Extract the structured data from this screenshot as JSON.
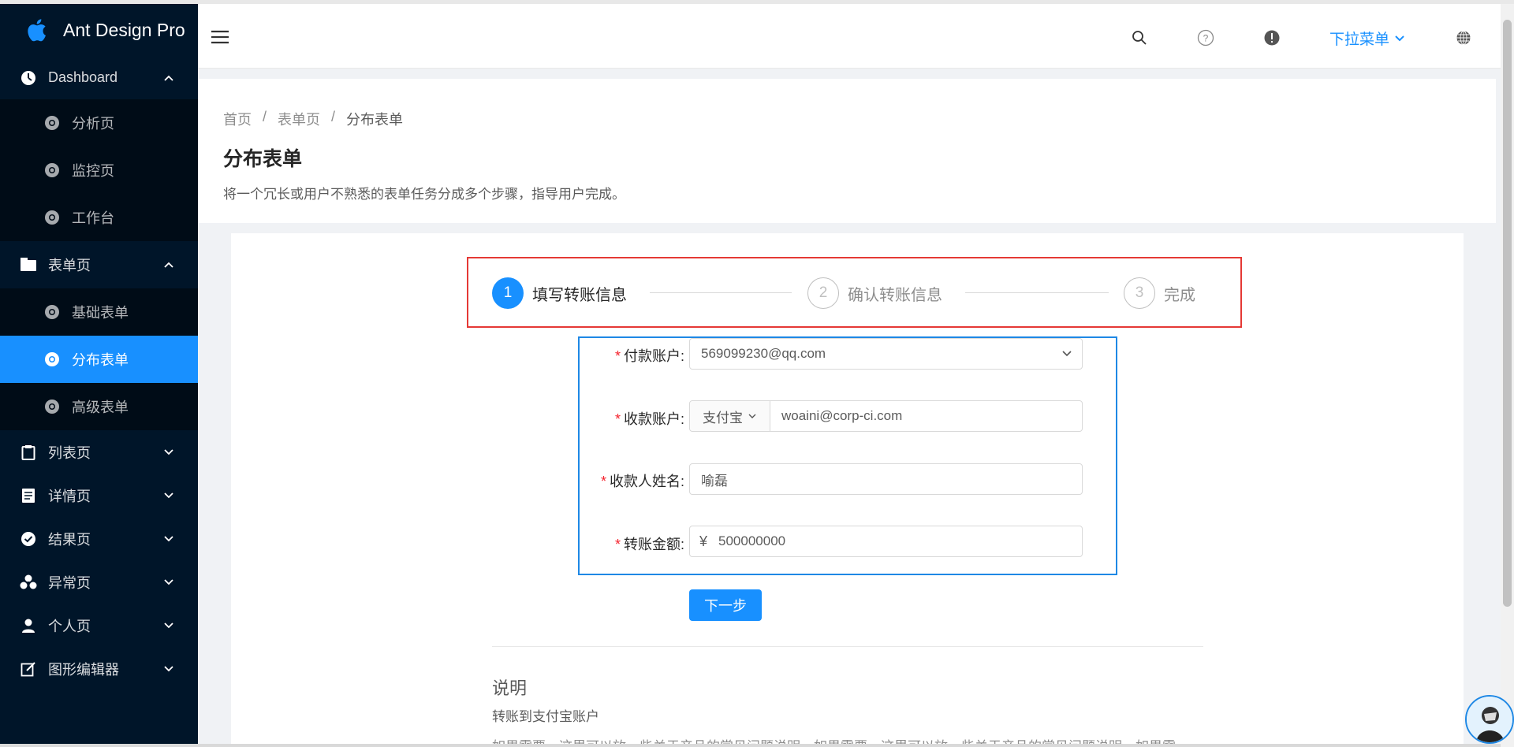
{
  "brand": {
    "title": "Ant Design Pro"
  },
  "sidebar": {
    "items": [
      {
        "label": "Dashboard",
        "icon": "dashboard-icon",
        "expanded": true
      },
      {
        "label": "分析页",
        "icon": "chrome-icon"
      },
      {
        "label": "监控页",
        "icon": "chrome-icon"
      },
      {
        "label": "工作台",
        "icon": "chrome-icon"
      },
      {
        "label": "表单页",
        "icon": "form-icon",
        "expanded": true
      },
      {
        "label": "基础表单",
        "icon": "chrome-icon"
      },
      {
        "label": "分布表单",
        "icon": "chrome-icon",
        "selected": true
      },
      {
        "label": "高级表单",
        "icon": "chrome-icon"
      },
      {
        "label": "列表页",
        "icon": "clipboard-icon"
      },
      {
        "label": "详情页",
        "icon": "profile-icon"
      },
      {
        "label": "结果页",
        "icon": "check-circle-icon"
      },
      {
        "label": "异常页",
        "icon": "warning-icon"
      },
      {
        "label": "个人页",
        "icon": "user-icon"
      },
      {
        "label": "图形编辑器",
        "icon": "edit-icon"
      }
    ]
  },
  "header": {
    "dropdown_label": "下拉菜单",
    "icons": [
      "search-icon",
      "question-icon",
      "notice-icon",
      "language-icon"
    ]
  },
  "page": {
    "breadcrumb": [
      "首页",
      "表单页",
      "分布表单"
    ],
    "title": "分布表单",
    "description": "将一个冗长或用户不熟悉的表单任务分成多个步骤，指导用户完成。"
  },
  "steps": [
    {
      "num": "1",
      "title": "填写转账信息",
      "status": "active"
    },
    {
      "num": "2",
      "title": "确认转账信息",
      "status": "wait"
    },
    {
      "num": "3",
      "title": "完成",
      "status": "wait"
    }
  ],
  "form": {
    "pay_account": {
      "label": "付款账户",
      "value": "569099230@qq.com"
    },
    "receiver_account": {
      "label": "收款账户",
      "type": "支付宝",
      "value": "woaini@corp-ci.com"
    },
    "receiver_name": {
      "label": "收款人姓名",
      "value": "喻磊"
    },
    "amount": {
      "label": "转账金额",
      "prefix": "¥",
      "value": "500000000"
    },
    "colon": ":",
    "required_mark": "*",
    "next_button": "下一步"
  },
  "explain": {
    "title": "说明",
    "subtitle": "转账到支付宝账户",
    "text": "如果需要，这里可以放一些关于产品的常见问题说明。如果需要，这里可以放一些关于产品的常见问题说明。如果需"
  },
  "colors": {
    "primary": "#1890ff",
    "sider": "#001529",
    "highlight_red": "#e53935",
    "highlight_blue": "#1e88e5"
  }
}
